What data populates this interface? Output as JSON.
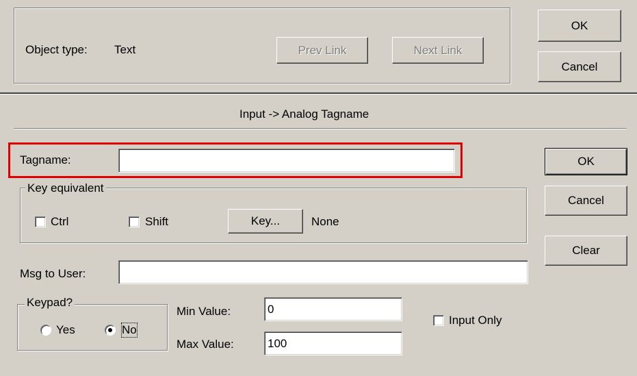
{
  "top_panel": {
    "object_type_label": "Object type:",
    "object_type_value": "Text",
    "prev_link_label": "Prev Link",
    "next_link_label": "Next Link",
    "ok_label": "OK",
    "cancel_label": "Cancel"
  },
  "dialog": {
    "title": "Input -> Analog Tagname",
    "tagname_label": "Tagname:",
    "tagname_value": "",
    "key_equivalent": {
      "legend": "Key equivalent",
      "ctrl_label": "Ctrl",
      "ctrl_checked": false,
      "shift_label": "Shift",
      "shift_checked": false,
      "key_button_label": "Key...",
      "key_value": "None"
    },
    "msg_to_user_label": "Msg to User:",
    "msg_to_user_value": "",
    "keypad": {
      "legend": "Keypad?",
      "yes_label": "Yes",
      "no_label": "No",
      "selected": "No"
    },
    "min_value_label": "Min Value:",
    "min_value": "0",
    "max_value_label": "Max Value:",
    "max_value": "100",
    "input_only_label": "Input Only",
    "input_only_checked": false,
    "ok_label": "OK",
    "cancel_label": "Cancel",
    "clear_label": "Clear"
  },
  "highlight_color": "#e00000",
  "colors": {
    "face": "#d4d0c8",
    "shadow": "#808080",
    "highlight": "#ffffff"
  }
}
